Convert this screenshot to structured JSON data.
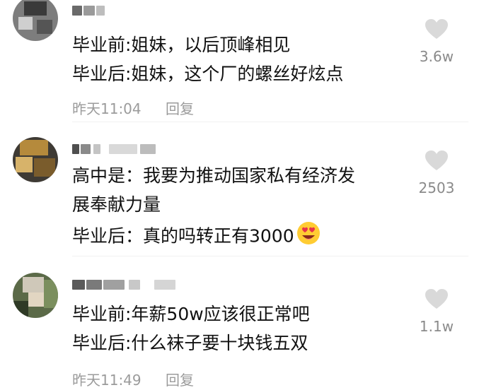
{
  "comments": [
    {
      "lines": [
        "毕业前:姐妹，以后顶峰相见",
        "毕业后:姐妹，这个厂的螺丝好炫点"
      ],
      "time": "昨天11:04",
      "reply": "回复",
      "likes": "3.6w"
    },
    {
      "lines": [
        "高中是：我要为推动国家私有经济发",
        "展奉献力量",
        "毕业后：真的吗转正有3000"
      ],
      "emoji": "heart-eyes-emoji",
      "likes": "2503"
    },
    {
      "lines": [
        "毕业前:年薪50w应该很正常吧",
        "毕业后:什么袜子要十块钱五双"
      ],
      "time": "昨天11:49",
      "reply": "回复",
      "likes": "1.1w"
    }
  ],
  "colors": {
    "meta": "#9b9b9b",
    "like_icon": "#d9d9d9",
    "count": "#8a8a8a"
  }
}
